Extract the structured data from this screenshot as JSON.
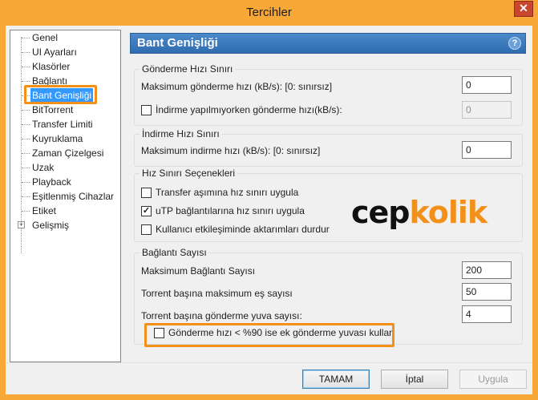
{
  "window": {
    "title": "Tercihler",
    "close_label": "✕"
  },
  "tree": {
    "items": [
      {
        "label": "Genel"
      },
      {
        "label": "UI Ayarları"
      },
      {
        "label": "Klasörler"
      },
      {
        "label": "Bağlantı"
      },
      {
        "label": "Bant Genişliği",
        "selected": true
      },
      {
        "label": "BitTorrent"
      },
      {
        "label": "Transfer Limiti"
      },
      {
        "label": "Kuyruklama"
      },
      {
        "label": "Zaman Çizelgesi"
      },
      {
        "label": "Uzak"
      },
      {
        "label": "Playback"
      },
      {
        "label": "Eşitlenmiş Cihazlar"
      },
      {
        "label": "Etiket"
      },
      {
        "label": "Gelişmiş",
        "expander": "+"
      }
    ]
  },
  "panel": {
    "title": "Bant Genişliği",
    "help": "?"
  },
  "upload": {
    "group_title": "Gönderme Hızı Sınırı",
    "max_label": "Maksimum gönderme hızı (kB/s): [0: sınırsız]",
    "max_value": "0",
    "while_download_label": "İndirme yapılmıyorken gönderme hızı(kB/s):",
    "while_download_checked": false,
    "while_download_value": "0"
  },
  "download": {
    "group_title": "İndirme Hızı Sınırı",
    "max_label": "Maksimum indirme hızı (kB/s): [0: sınırsız]",
    "max_value": "0"
  },
  "limits": {
    "group_title": "Hız Sınırı Seçenekleri",
    "options": [
      {
        "label": "Transfer aşımına hız sınırı uygula",
        "checked": false
      },
      {
        "label": "uTP bağlantılarına hız sınırı uygula",
        "checked": true
      },
      {
        "label": "Kullanıcı etkileşiminde aktarımları durdur",
        "checked": false
      }
    ]
  },
  "connections": {
    "group_title": "Bağlantı Sayısı",
    "max_conn_label": "Maksimum Bağlantı Sayısı",
    "max_conn_value": "200",
    "peers_label": "Torrent başına maksimum eş sayısı",
    "peers_value": "50",
    "slots_label": "Torrent başına gönderme yuva sayısı:",
    "slots_value": "4",
    "extra_slot_label": "Gönderme hızı < %90 ise ek gönderme yuvası kullan",
    "extra_slot_checked": false
  },
  "watermark": {
    "part1": "cep",
    "part2": "kolik"
  },
  "buttons": {
    "ok": "TAMAM",
    "cancel": "İptal",
    "apply": "Uygula"
  },
  "colors": {
    "accent": "#f39019",
    "header": "#2f6cb0"
  }
}
